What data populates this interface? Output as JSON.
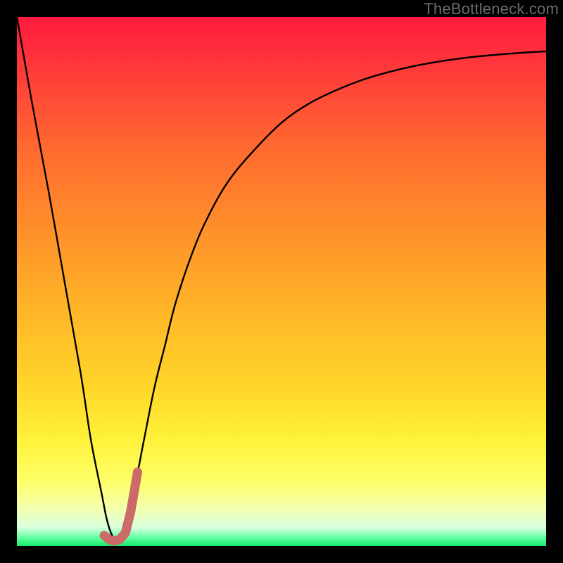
{
  "watermark": "TheBottleneck.com",
  "colors": {
    "frame": "#000000",
    "gradient_stops": [
      {
        "offset": 0.0,
        "color": "#ff1a3e"
      },
      {
        "offset": 0.1,
        "color": "#ff3a3a"
      },
      {
        "offset": 0.25,
        "color": "#ff6a2f"
      },
      {
        "offset": 0.4,
        "color": "#ff8f2a"
      },
      {
        "offset": 0.55,
        "color": "#ffb428"
      },
      {
        "offset": 0.7,
        "color": "#ffd629"
      },
      {
        "offset": 0.8,
        "color": "#fff23a"
      },
      {
        "offset": 0.88,
        "color": "#fdff6a"
      },
      {
        "offset": 0.93,
        "color": "#f3ffb0"
      },
      {
        "offset": 0.965,
        "color": "#d8ffde"
      },
      {
        "offset": 0.985,
        "color": "#5dff9e"
      },
      {
        "offset": 1.0,
        "color": "#15e86a"
      }
    ],
    "curve": "#000000",
    "segment": "#cb6a66"
  },
  "chart_data": {
    "type": "line",
    "title": "",
    "xlabel": "",
    "ylabel": "",
    "xlim": [
      0,
      100
    ],
    "ylim": [
      0,
      100
    ],
    "series": [
      {
        "name": "bottleneck-curve",
        "x": [
          0,
          3,
          6,
          9,
          12,
          14,
          16,
          17,
          18,
          19,
          20,
          22,
          24,
          26,
          28,
          30,
          33,
          36,
          40,
          45,
          50,
          55,
          60,
          65,
          70,
          75,
          80,
          85,
          90,
          95,
          100
        ],
        "values": [
          100,
          83,
          67,
          50,
          33,
          20,
          10,
          5,
          2,
          1,
          3,
          10,
          20,
          30,
          38,
          46,
          55,
          62,
          69,
          75,
          80,
          83.5,
          86,
          88,
          89.5,
          90.7,
          91.6,
          92.3,
          92.8,
          93.2,
          93.5
        ]
      },
      {
        "name": "highlighted-segment",
        "x": [
          16.5,
          17.5,
          18.5,
          19.5,
          20.5,
          21.5,
          22.2,
          22.8
        ],
        "values": [
          2.0,
          1.2,
          1.0,
          1.3,
          2.5,
          6.5,
          10.5,
          14.0
        ]
      }
    ]
  }
}
